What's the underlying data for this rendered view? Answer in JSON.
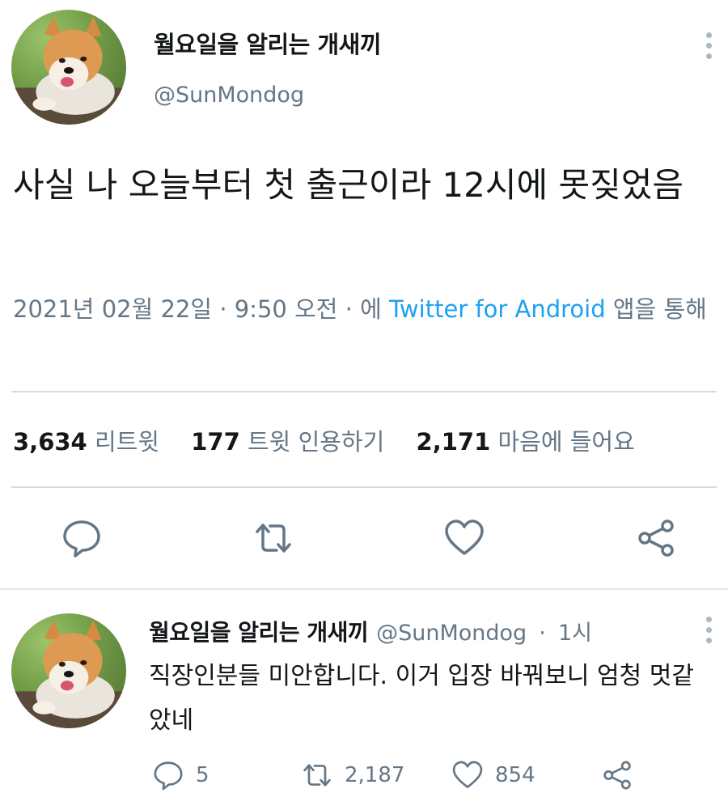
{
  "tweet": {
    "author_name": "월요일을 알리는 개새끼",
    "author_handle": "@SunMondog",
    "text": "사실 나 오늘부터 첫 출근이라 12시에 못짖었음",
    "date": "2021년 02월 22일",
    "time": "9:50 오전",
    "via_prefix": "에",
    "source_app": "Twitter for Android",
    "via_suffix": "앱을 통해",
    "separator": "·"
  },
  "stats": {
    "retweets_count": "3,634",
    "retweets_label": "리트윗",
    "quotes_count": "177",
    "quotes_label": "트윗 인용하기",
    "likes_count": "2,171",
    "likes_label": "마음에 들어요"
  },
  "icons": {
    "reply": "reply-icon",
    "retweet": "retweet-icon",
    "like": "heart-icon",
    "share": "share-icon",
    "more": "more-vertical-icon"
  },
  "reply": {
    "author_name": "월요일을 알리는 개새끼",
    "author_handle": "@SunMondog",
    "time_ago": "1시",
    "separator": "·",
    "text": "직장인분들 미안합니다. 이거 입장 바꿔보니 엄청 멋같았네",
    "reply_count": "5",
    "retweet_count": "2,187",
    "like_count": "854"
  },
  "colors": {
    "accent": "#1da1f2",
    "muted": "#657786",
    "text": "#14171a",
    "divider": "#e1e8ed"
  }
}
